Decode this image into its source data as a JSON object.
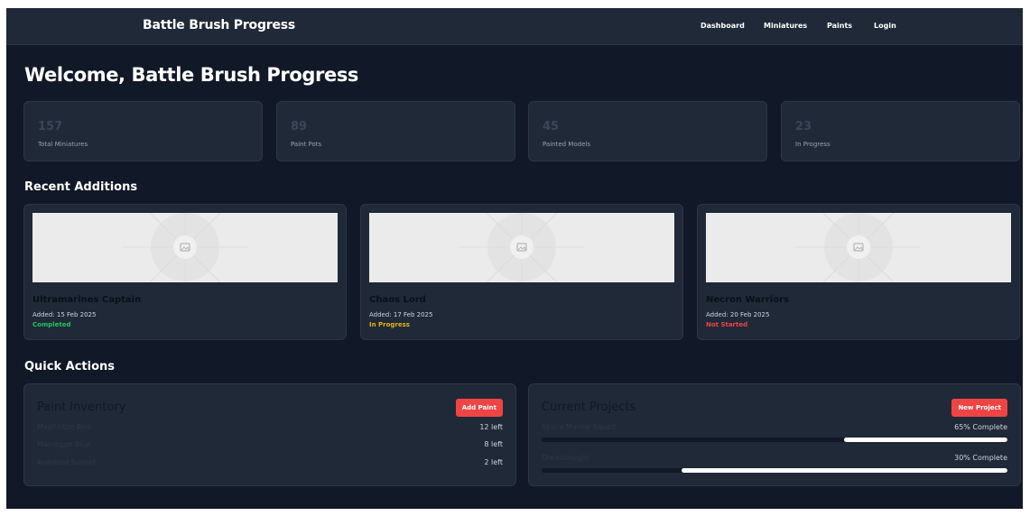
{
  "header": {
    "brand": "Battle Brush Progress",
    "nav": [
      {
        "label": "Dashboard"
      },
      {
        "label": "Miniatures"
      },
      {
        "label": "Paints"
      },
      {
        "label": "Login"
      }
    ]
  },
  "welcome": "Welcome, Battle Brush Progress",
  "stats": [
    {
      "value": "157",
      "label": "Total Miniatures"
    },
    {
      "value": "89",
      "label": "Paint Pots"
    },
    {
      "value": "45",
      "label": "Painted Models"
    },
    {
      "value": "23",
      "label": "In Progress"
    }
  ],
  "recent": {
    "title": "Recent Additions",
    "items": [
      {
        "name": "Ultramarines Captain",
        "date": "Added: 15 Feb 2025",
        "status": "Completed",
        "status_color": "#22c55e",
        "image_icon": "image-placeholder-icon"
      },
      {
        "name": "Chaos Lord",
        "date": "Added: 17 Feb 2025",
        "status": "In Progress",
        "status_color": "#eab308",
        "image_icon": "image-placeholder-icon"
      },
      {
        "name": "Necron Warriors",
        "date": "Added: 20 Feb 2025",
        "status": "Not Started",
        "status_color": "#ef4444",
        "image_icon": "image-placeholder-icon"
      }
    ]
  },
  "quick": {
    "title": "Quick Actions",
    "inventory": {
      "title": "Paint Inventory",
      "button": "Add Paint",
      "items": [
        {
          "name": "Mephiston Red",
          "count": "12 left"
        },
        {
          "name": "Macragge Blue",
          "count": "8 left"
        },
        {
          "name": "Averland Sunset",
          "count": "2 left"
        }
      ]
    },
    "projects": {
      "title": "Current Projects",
      "button": "New Project",
      "items": [
        {
          "name": "Space Marine Squad",
          "progress_label": "65% Complete",
          "progress": 0.35
        },
        {
          "name": "Dreadnought",
          "progress_label": "30% Complete",
          "progress": 0.7
        }
      ]
    }
  },
  "colors": {
    "background": "#111827",
    "card": "#1f2937",
    "accent_button": "#ef4444",
    "completed": "#22c55e",
    "in_progress": "#eab308",
    "not_started": "#ef4444"
  }
}
